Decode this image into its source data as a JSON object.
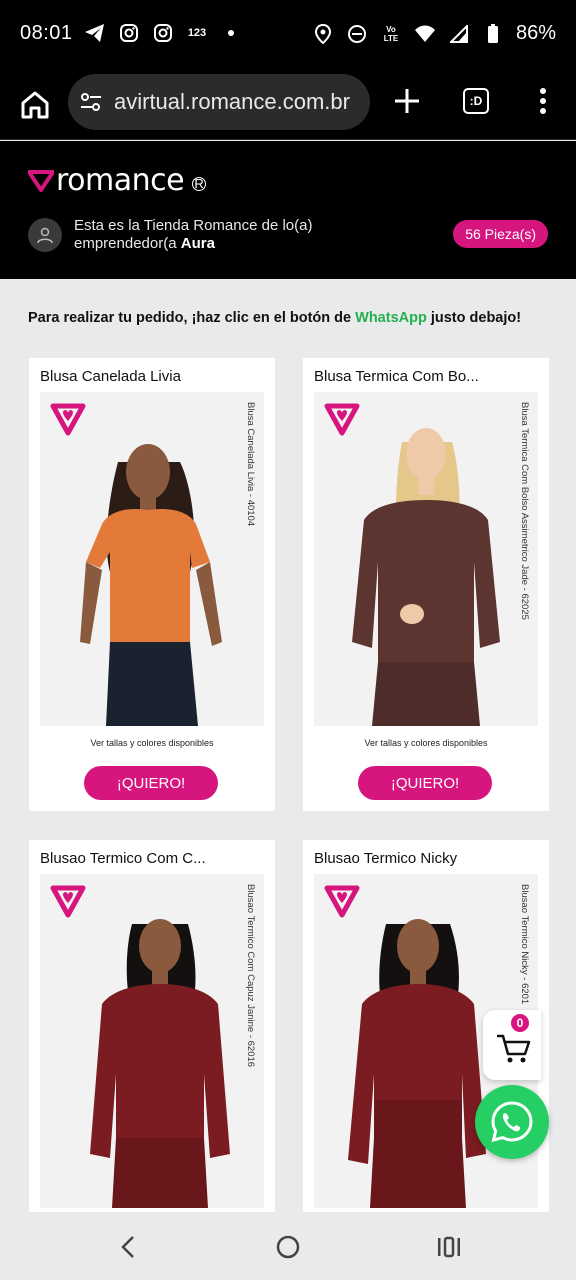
{
  "status_bar": {
    "time": "08:01",
    "left_icons": [
      "telegram-icon",
      "instagram-icon",
      "instagram-icon",
      "data-counter-icon",
      "dot-icon"
    ],
    "data_counter_label": "123",
    "right_icons": [
      "location-icon",
      "dnd-icon",
      "volte-icon",
      "wifi-icon",
      "signal-icon",
      "battery-icon"
    ],
    "volte_label": "Vo LTE",
    "battery": "86%"
  },
  "browser": {
    "url": "avirtual.romance.com.br",
    "tab_label": ":D"
  },
  "store_header": {
    "logo_text": "romance",
    "logo_mark": "R",
    "seller_text": "Esta es la Tienda Romance de lo(a) emprendedor(a",
    "seller_name": "Aura",
    "pieces_badge": "56 Pieza(s)"
  },
  "instruction": {
    "before": "Para realizar tu pedido, ¡haz clic en el botón de ",
    "highlight": "WhatsApp",
    "after": " justo debajo!"
  },
  "products": [
    {
      "title": "Blusa Canelada Livia",
      "vertical_label": "Blusa Canelada Livia - 40104",
      "sizes_text": "Ver tallas y colores disponibles",
      "button": "¡QUIERO!"
    },
    {
      "title": "Blusa Termica Com Bo...",
      "vertical_label": "Blusa Termica Com Bolso Assimetrico Jade - 62025",
      "sizes_text": "Ver tallas y colores disponibles",
      "button": "¡QUIERO!"
    },
    {
      "title": "Blusao Termico Com C...",
      "vertical_label": "Blusao Termico Com Capuz Janine - 62016"
    },
    {
      "title": "Blusao Termico Nicky",
      "vertical_label": "Blusao Termico Nicky - 6201"
    }
  ],
  "cart": {
    "count": "0"
  },
  "colors": {
    "brand_pink": "#d6157f",
    "whatsapp_green": "#25cf63",
    "whatsapp_text": "#25b14c",
    "header_bg": "#000000"
  }
}
